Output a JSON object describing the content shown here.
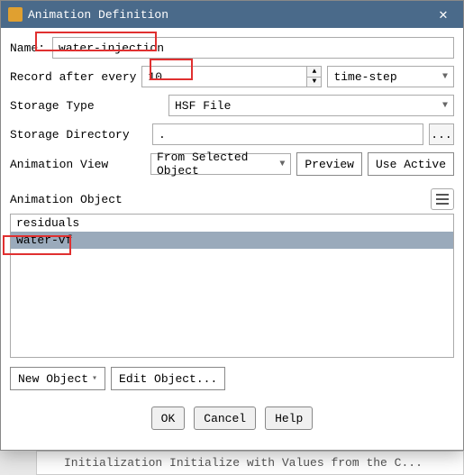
{
  "window": {
    "title": "Animation Definition"
  },
  "labels": {
    "name": "Name:",
    "record": "Record after every",
    "storage_type": "Storage Type",
    "storage_dir": "Storage Directory",
    "animation_view": "Animation View",
    "animation_object": "Animation Object"
  },
  "fields": {
    "name": "water-injection",
    "record_every": "10",
    "record_unit": "time-step",
    "storage_type": "HSF File",
    "storage_dir": ".",
    "animation_view": "From Selected Object"
  },
  "buttons": {
    "dir_browse": "...",
    "preview": "Preview",
    "use_active": "Use Active",
    "new_object": "New Object",
    "edit_object": "Edit Object...",
    "ok": "OK",
    "cancel": "Cancel",
    "help": "Help"
  },
  "list": {
    "items": [
      "residuals",
      "water-vf"
    ],
    "selected_index": 1
  },
  "below_text": "Initialization  Initialize with Values from the C..."
}
